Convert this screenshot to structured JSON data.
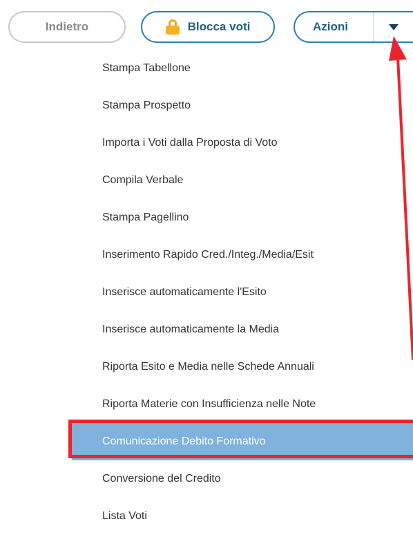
{
  "toolbar": {
    "back_label": "Indietro",
    "lock_label": "Blocca voti",
    "actions_label": "Azioni"
  },
  "menu": {
    "items": [
      {
        "label": "Stampa Tabellone"
      },
      {
        "label": "Stampa Prospetto"
      },
      {
        "label": "Importa i Voti dalla Proposta di Voto"
      },
      {
        "label": "Compila Verbale"
      },
      {
        "label": "Stampa Pagellino"
      },
      {
        "label": "Inserimento Rapido Cred./Integ./Media/Esit"
      },
      {
        "label": "Inserisce automaticamente l'Esito"
      },
      {
        "label": "Inserisce automaticamente la Media"
      },
      {
        "label": "Riporta Esito e Media nelle Schede Annuali"
      },
      {
        "label": "Riporta Materie con Insufficienza nelle Note"
      },
      {
        "label": "Comunicazione Debito Formativo"
      },
      {
        "label": "Conversione del Credito"
      },
      {
        "label": "Lista Voti"
      }
    ],
    "selected_index": 10
  },
  "colors": {
    "accent_border": "#2f7fb0",
    "selected_bg": "#7fb2dc",
    "annotation_red": "#e8262d",
    "lock_icon": "#f5b21e"
  }
}
